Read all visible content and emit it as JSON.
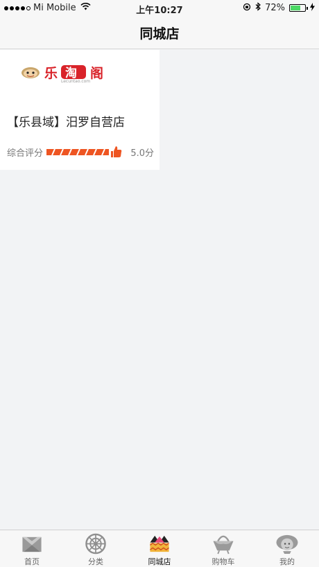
{
  "status_bar": {
    "carrier": "Mi Mobile",
    "time": "上午10:27",
    "battery_percent": "72%",
    "battery_level": 0.72
  },
  "nav": {
    "title": "同城店"
  },
  "shop": {
    "logo_text": "乐淘阁",
    "logo_subtext": "Lecuntao.com",
    "name": "【乐县域】汨罗自营店",
    "rating_label": "综合评分",
    "rating_value": "5.0分",
    "rating_fraction": 1.0
  },
  "tabs": [
    {
      "label": "首页",
      "icon": "home-icon"
    },
    {
      "label": "分类",
      "icon": "category-icon"
    },
    {
      "label": "同城店",
      "icon": "local-store-icon",
      "active": true
    },
    {
      "label": "购物车",
      "icon": "cart-basket-icon"
    },
    {
      "label": "我的",
      "icon": "profile-icon"
    }
  ],
  "colors": {
    "rating_accent": "#ee5522",
    "logo_red": "#d9232a",
    "battery_green": "#4cd964"
  }
}
